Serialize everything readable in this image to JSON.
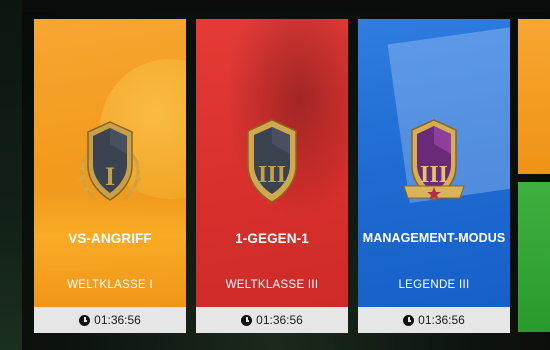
{
  "cards": [
    {
      "title": "VS-ANGRIFF",
      "rank": "WELTKLASSE I",
      "numeral": "I",
      "timer": "01:36:56"
    },
    {
      "title": "1-GEGEN-1",
      "rank": "WELTKLASSE III",
      "numeral": "III",
      "timer": "01:36:56"
    },
    {
      "title": "MANAGEMENT-MODUS",
      "rank": "LEGENDE III",
      "numeral": "III",
      "timer": "01:36:56"
    }
  ],
  "colors": {
    "orange": "#f29b1f",
    "red": "#d8302d",
    "blue": "#1f6bd2",
    "green": "#2a9a2e",
    "gold": "#d9b45b"
  },
  "icons": {
    "clock": "clock-icon",
    "badge": "rank-shield-icon"
  }
}
